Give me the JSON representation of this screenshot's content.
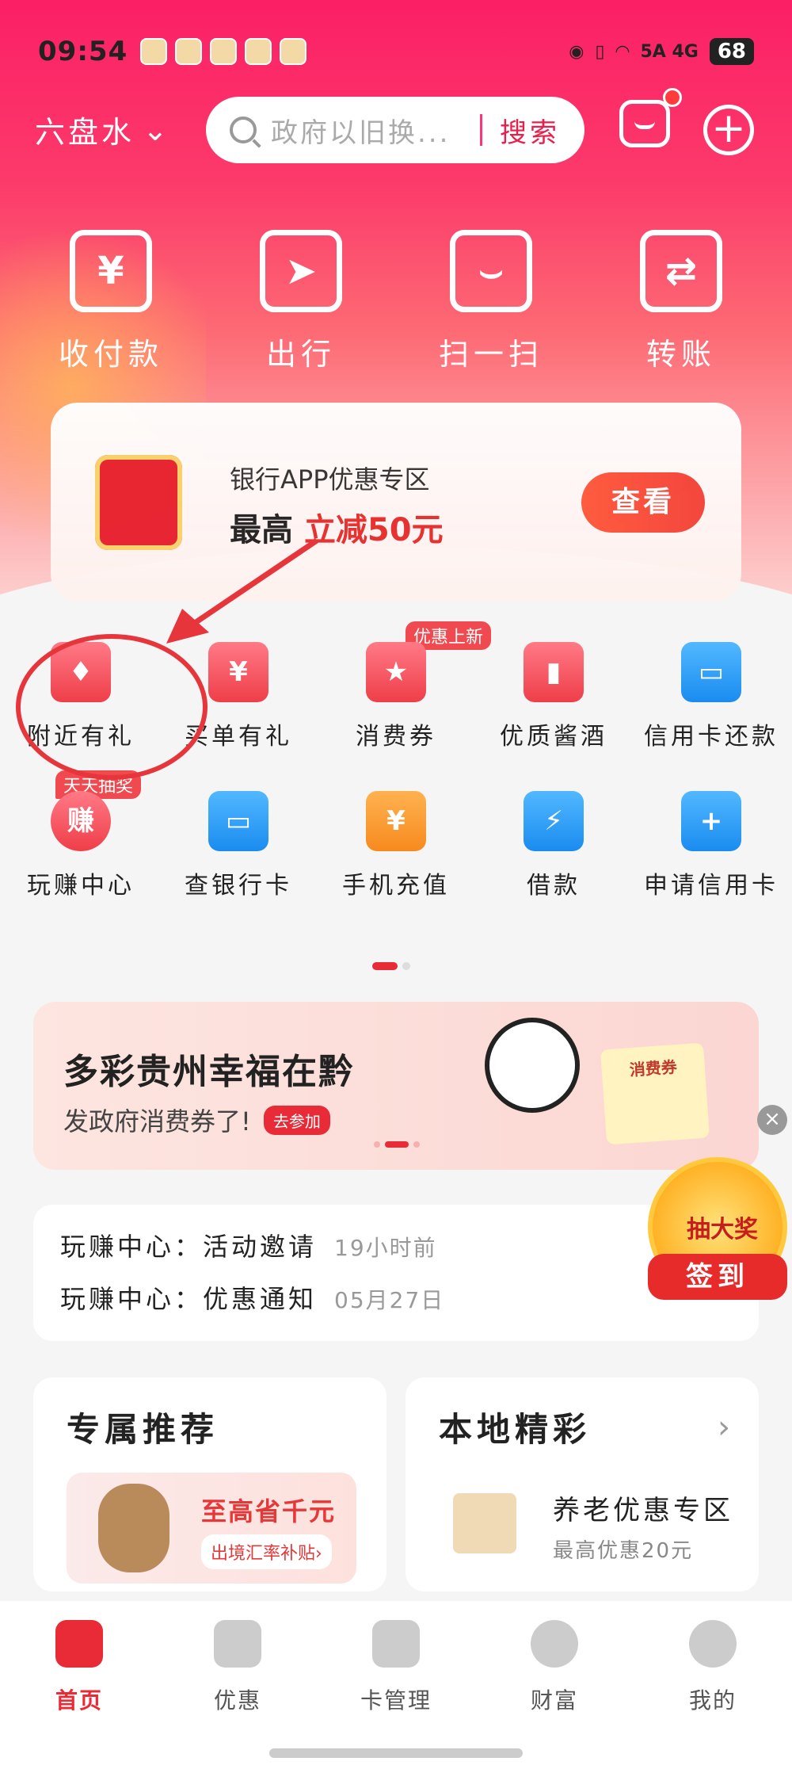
{
  "status_bar": {
    "time": "09:54",
    "network": "5A  4G",
    "battery": "68"
  },
  "header": {
    "city": "六盘水",
    "search_placeholder": "政府以旧换...",
    "search_button": "搜索"
  },
  "quick_actions": [
    {
      "label": "收付款",
      "glyph": "¥"
    },
    {
      "label": "出行",
      "glyph": "➤"
    },
    {
      "label": "扫一扫",
      "glyph": "⌣"
    },
    {
      "label": "转账",
      "glyph": "⇄"
    }
  ],
  "promo": {
    "title": "银行APP优惠专区",
    "prefix": "最高",
    "highlight": "立减50元",
    "button": "查看"
  },
  "grid": [
    [
      {
        "label": "附近有礼",
        "glyph": "♦",
        "color": "red",
        "tag": ""
      },
      {
        "label": "买单有礼",
        "glyph": "¥",
        "color": "red",
        "tag": ""
      },
      {
        "label": "消费券",
        "glyph": "★",
        "color": "red",
        "tag": "优惠上新"
      },
      {
        "label": "优质酱酒",
        "glyph": "▮",
        "color": "red",
        "tag": ""
      },
      {
        "label": "信用卡还款",
        "glyph": "▭",
        "color": "blue",
        "tag": ""
      }
    ],
    [
      {
        "label": "玩赚中心",
        "glyph": "赚",
        "color": "red",
        "tag": "天天抽奖"
      },
      {
        "label": "查银行卡",
        "glyph": "▭",
        "color": "blue",
        "tag": ""
      },
      {
        "label": "手机充值",
        "glyph": "¥",
        "color": "orange",
        "tag": ""
      },
      {
        "label": "借款",
        "glyph": "⚡",
        "color": "blue",
        "tag": ""
      },
      {
        "label": "申请信用卡",
        "glyph": "+",
        "color": "blue",
        "tag": ""
      }
    ]
  ],
  "banner": {
    "title": "多彩贵州幸福在黔",
    "subtitle": "发政府消费券了!",
    "join": "去参加",
    "coupon": "消费券"
  },
  "notices": [
    {
      "text": "玩赚中心：活动邀请",
      "time": "19小时前"
    },
    {
      "text": "玩赚中心：优惠通知",
      "time": "05月27日"
    }
  ],
  "lottery": {
    "title": "抽大奖",
    "button": "签到"
  },
  "cards": {
    "recommend": {
      "title": "专属推荐",
      "line1": "至高省千元",
      "line2": "出境汇率补贴›"
    },
    "local": {
      "title": "本地精彩",
      "item": "养老优惠专区",
      "sub": "最高优惠20元"
    }
  },
  "tabs": [
    {
      "label": "首页",
      "active": true
    },
    {
      "label": "优惠",
      "active": false
    },
    {
      "label": "卡管理",
      "active": false
    },
    {
      "label": "财富",
      "active": false
    },
    {
      "label": "我的",
      "active": false
    }
  ],
  "colors": {
    "brand": "#e92b37",
    "hero_top": "#fb1f66",
    "accent_blue": "#1a8cf0"
  }
}
